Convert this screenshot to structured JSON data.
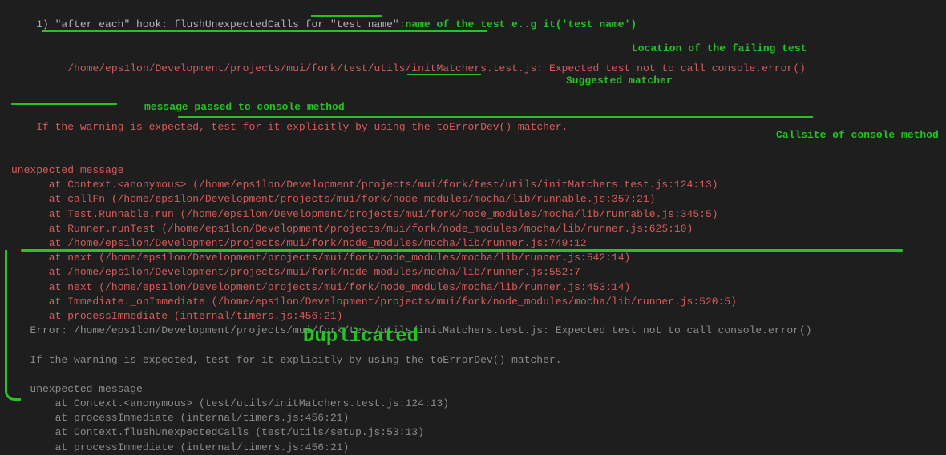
{
  "header": {
    "index": "1) ",
    "prefix": "\"after each\" hook: flushUnexpectedCalls for ",
    "testname_quoted": "\"test name\"",
    "colon": ":"
  },
  "annotations": {
    "testname": "name of the test e..g it('test name')",
    "location": "Location of the failing test",
    "matcher": "Suggested matcher",
    "msgpassed": "message passed to console method",
    "callsite": "Callsite of console method",
    "duplicated": "Duplicated"
  },
  "redblock": {
    "path": "/home/eps1lon/Development/projects/mui/fork/test/utils/initMatchers.test.js",
    "expected": ": Expected test not to call console.error()",
    "advice_pre": "If the warning is expected, test for it explicitly by using the ",
    "advice_matcher": "toErrorDev()",
    "advice_post": " matcher.",
    "unexpected": "unexpected message",
    "stack": [
      "      at Context.<anonymous> (/home/eps1lon/Development/projects/mui/fork/test/utils/initMatchers.test.js:124:13)",
      "      at callFn (/home/eps1lon/Development/projects/mui/fork/node_modules/mocha/lib/runnable.js:357:21)",
      "      at Test.Runnable.run (/home/eps1lon/Development/projects/mui/fork/node_modules/mocha/lib/runnable.js:345:5)",
      "      at Runner.runTest (/home/eps1lon/Development/projects/mui/fork/node_modules/mocha/lib/runner.js:625:10)",
      "      at /home/eps1lon/Development/projects/mui/fork/node_modules/mocha/lib/runner.js:749:12",
      "      at next (/home/eps1lon/Development/projects/mui/fork/node_modules/mocha/lib/runner.js:542:14)",
      "      at /home/eps1lon/Development/projects/mui/fork/node_modules/mocha/lib/runner.js:552:7",
      "      at next (/home/eps1lon/Development/projects/mui/fork/node_modules/mocha/lib/runner.js:453:14)",
      "      at Immediate._onImmediate (/home/eps1lon/Development/projects/mui/fork/node_modules/mocha/lib/runner.js:520:5)",
      "      at processImmediate (internal/timers.js:456:21)"
    ]
  },
  "grayblock": {
    "error_pre": "   Error: ",
    "path": "/home/eps1lon/Development/projects/mui/fork/test/utils/initMatchers.test.js",
    "expected": ": Expected test not to call console.error()",
    "advice": "   If the warning is expected, test for it explicitly by using the toErrorDev() matcher.",
    "unexpected": "   unexpected message",
    "stack": [
      "       at Context.<anonymous> (test/utils/initMatchers.test.js:124:13)",
      "       at processImmediate (internal/timers.js:456:21)",
      "       at Context.flushUnexpectedCalls (test/utils/setup.js:53:13)",
      "       at processImmediate (internal/timers.js:456:21)"
    ]
  }
}
